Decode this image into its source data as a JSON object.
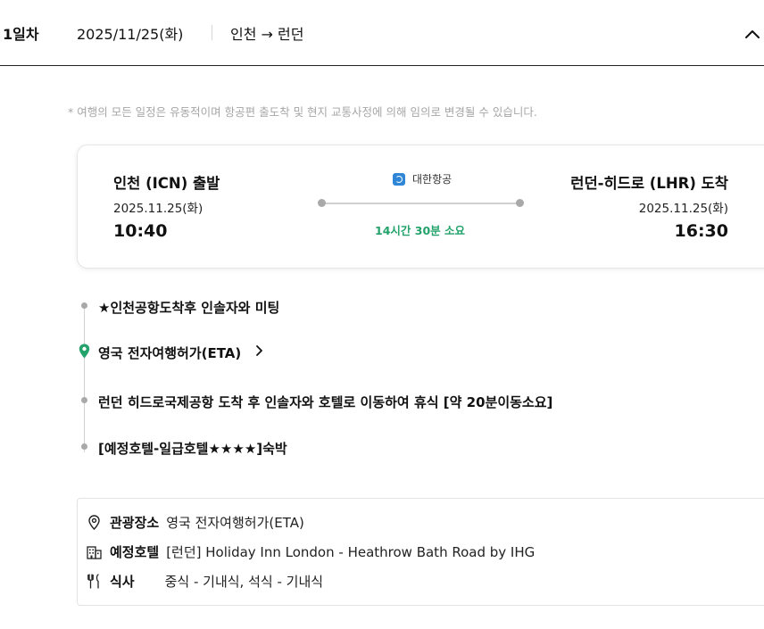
{
  "day": {
    "label": "1일차",
    "date": "2025/11/25(화)",
    "route": "인천 → 런던"
  },
  "notice": "* 여행의 모든 일정은 유동적이며 항공편 출도착 및 현지 교통사정에 의해 임의로 변경될 수 있습니다.",
  "flight": {
    "departure": {
      "city": "인천 (ICN) 출발",
      "date": "2025.11.25(화)",
      "time": "10:40"
    },
    "arrival": {
      "city": "런던-히드로 (LHR) 도착",
      "date": "2025.11.25(화)",
      "time": "16:30"
    },
    "airline": "대한항공",
    "duration": "14시간 30분 소요"
  },
  "timeline": [
    {
      "text": "★인천공항도착후 인솔자와 미팅",
      "marker": "dot"
    },
    {
      "text": "영국 전자여행허가(ETA)",
      "marker": "pin",
      "link": true
    },
    {
      "text": "런던 히드로국제공항 도착 후 인솔자와 호텔로 이동하여 휴식 [약 20분이동소요]",
      "marker": "dot"
    },
    {
      "text": "[예정호텔-일급호텔★★★★]숙박",
      "marker": "dot"
    }
  ],
  "info": {
    "sightseeing": {
      "label": "관광장소",
      "value": "영국 전자여행허가(ETA)",
      "icon": "location-pin-icon"
    },
    "hotel": {
      "label": "예정호텔",
      "value": "[런던] Holiday Inn London - Heathrow Bath Road by IHG",
      "icon": "hotel-building-icon"
    },
    "meal": {
      "label": "식사",
      "value": "중식 - 기내식, 석식 - 기내식",
      "icon": "fork-knife-icon"
    }
  },
  "colors": {
    "accent_green": "#23a36b",
    "muted_text": "#a6a6a6",
    "border": "#e3e3e3"
  }
}
